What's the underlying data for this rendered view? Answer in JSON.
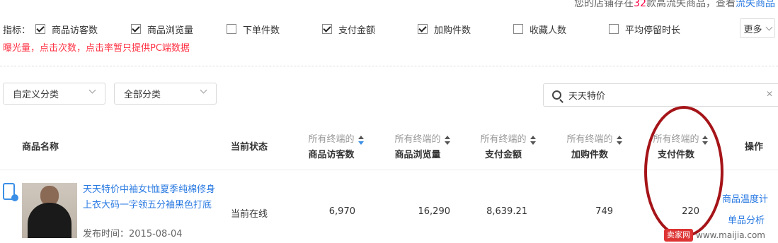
{
  "top_notice": {
    "prefix": "您的店铺存在",
    "count": "32",
    "middle": "款高流失商品，查看",
    "link": "流失商品"
  },
  "indicators": {
    "label": "指标：",
    "items": [
      {
        "label": "商品访客数",
        "checked": true
      },
      {
        "label": "商品浏览量",
        "checked": true
      },
      {
        "label": "下单件数",
        "checked": false
      },
      {
        "label": "支付金额",
        "checked": true
      },
      {
        "label": "加购件数",
        "checked": true
      },
      {
        "label": "收藏人数",
        "checked": false
      },
      {
        "label": "平均停留时长",
        "checked": false
      }
    ],
    "more_label": "更多"
  },
  "warning": "曝光量，点击次数，点击率暂只提供PC端数据",
  "filters": {
    "custom_category": "自定义分类",
    "all_category": "全部分类"
  },
  "search": {
    "value": "天天特价"
  },
  "table": {
    "headers": {
      "name": "商品名称",
      "status": "当前状态",
      "visitors_l1": "所有终端的",
      "visitors_l2": "商品访客数",
      "views_l1": "所有终端的",
      "views_l2": "商品浏览量",
      "amount_l1": "所有终端的",
      "amount_l2": "支付金额",
      "cart_l1": "所有终端的",
      "cart_l2": "加购件数",
      "paid_l1": "所有终端的",
      "paid_l2": "支付件数",
      "action": "操作"
    },
    "rows": [
      {
        "title": "天天特价中袖女t恤夏季纯棉修身上衣大码一字领五分袖黑色打底",
        "publish": "发布时间：2015-08-04",
        "status": "当前在线",
        "visitors": "6,970",
        "views": "16,290",
        "amount": "8,639.21",
        "cart": "749",
        "paid": "220",
        "action1": "商品温度计",
        "action2": "单品分析"
      }
    ]
  },
  "watermark": {
    "badge": "卖家网",
    "url": "www.maijia.com"
  }
}
